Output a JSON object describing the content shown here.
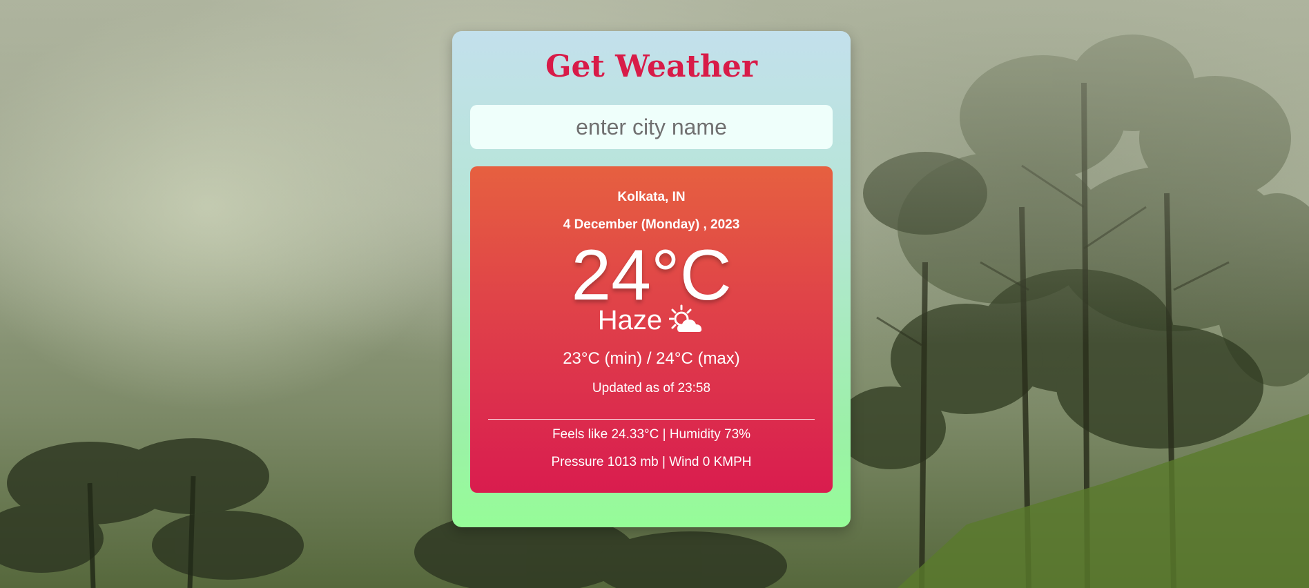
{
  "app": {
    "title": "Get Weather"
  },
  "search": {
    "placeholder": "enter city name",
    "value": ""
  },
  "weather": {
    "location": "Kolkata, IN",
    "date": "4 December (Monday) , 2023",
    "temperature": "24°C",
    "condition": "Haze",
    "condition_icon": "sun-behind-cloud-icon",
    "min_max": "23°C (min) / 24°C (max)",
    "updated": "Updated as of 23:58",
    "feels_humidity": "Feels like 24.33°C | Humidity 73%",
    "pressure_wind": "Pressure 1013 mb | Wind 0 KMPH"
  },
  "colors": {
    "title": "#d81b48",
    "card_gradient_top": "#c3e0ec",
    "card_gradient_bottom": "#96fc98",
    "result_gradient_top": "#e66040",
    "result_gradient_bottom": "#d91c4e"
  }
}
